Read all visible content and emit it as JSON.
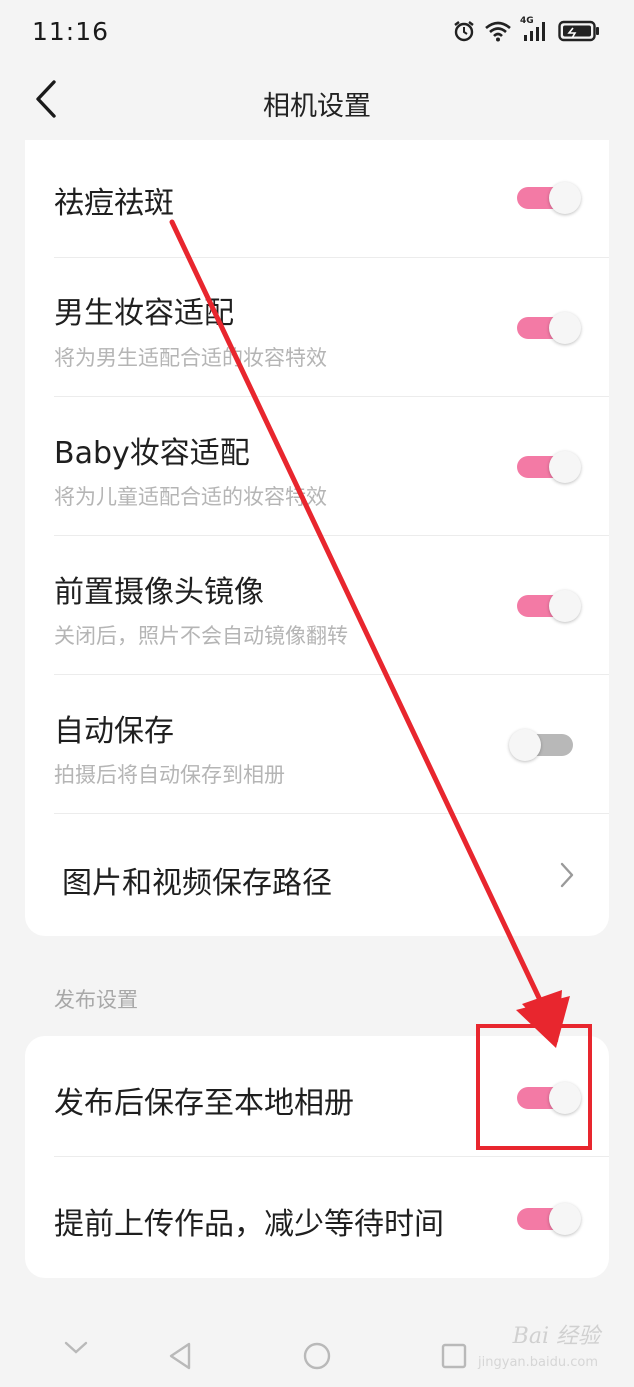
{
  "status_bar": {
    "time": "11:16",
    "icons": [
      "alarm-icon",
      "wifi-icon",
      "signal-4g-icon",
      "battery-icon"
    ],
    "network_label": "4G"
  },
  "header": {
    "title": "相机设置"
  },
  "camera_settings": [
    {
      "title": "祛痘祛斑",
      "subtitle": "",
      "control": "toggle",
      "enabled": true
    },
    {
      "title": "男生妆容适配",
      "subtitle": "将为男生适配合适的妆容特效",
      "control": "toggle",
      "enabled": true
    },
    {
      "title": "Baby妆容适配",
      "subtitle": "将为儿童适配合适的妆容特效",
      "control": "toggle",
      "enabled": true
    },
    {
      "title": "前置摄像头镜像",
      "subtitle": "关闭后，照片不会自动镜像翻转",
      "control": "toggle",
      "enabled": true
    },
    {
      "title": "自动保存",
      "subtitle": "拍摄后将自动保存到相册",
      "control": "toggle",
      "enabled": false
    },
    {
      "title": "图片和视频保存路径",
      "subtitle": "",
      "control": "chevron"
    }
  ],
  "publish_section": {
    "label": "发布设置",
    "items": [
      {
        "title": "发布后保存至本地相册",
        "control": "toggle",
        "enabled": true
      },
      {
        "title": "提前上传作品，减少等待时间",
        "control": "toggle",
        "enabled": true
      }
    ]
  },
  "nav_bar": {
    "icons": [
      "collapse-icon",
      "back-triangle-icon",
      "home-circle-icon",
      "recents-square-icon"
    ]
  },
  "watermark": {
    "text": "Bai 经验",
    "subtext": "jingyan.baidu.com"
  },
  "colors": {
    "toggle_on": "#f37aa5",
    "toggle_off": "#b8b8b8",
    "annotation_red": "#e8262e"
  }
}
